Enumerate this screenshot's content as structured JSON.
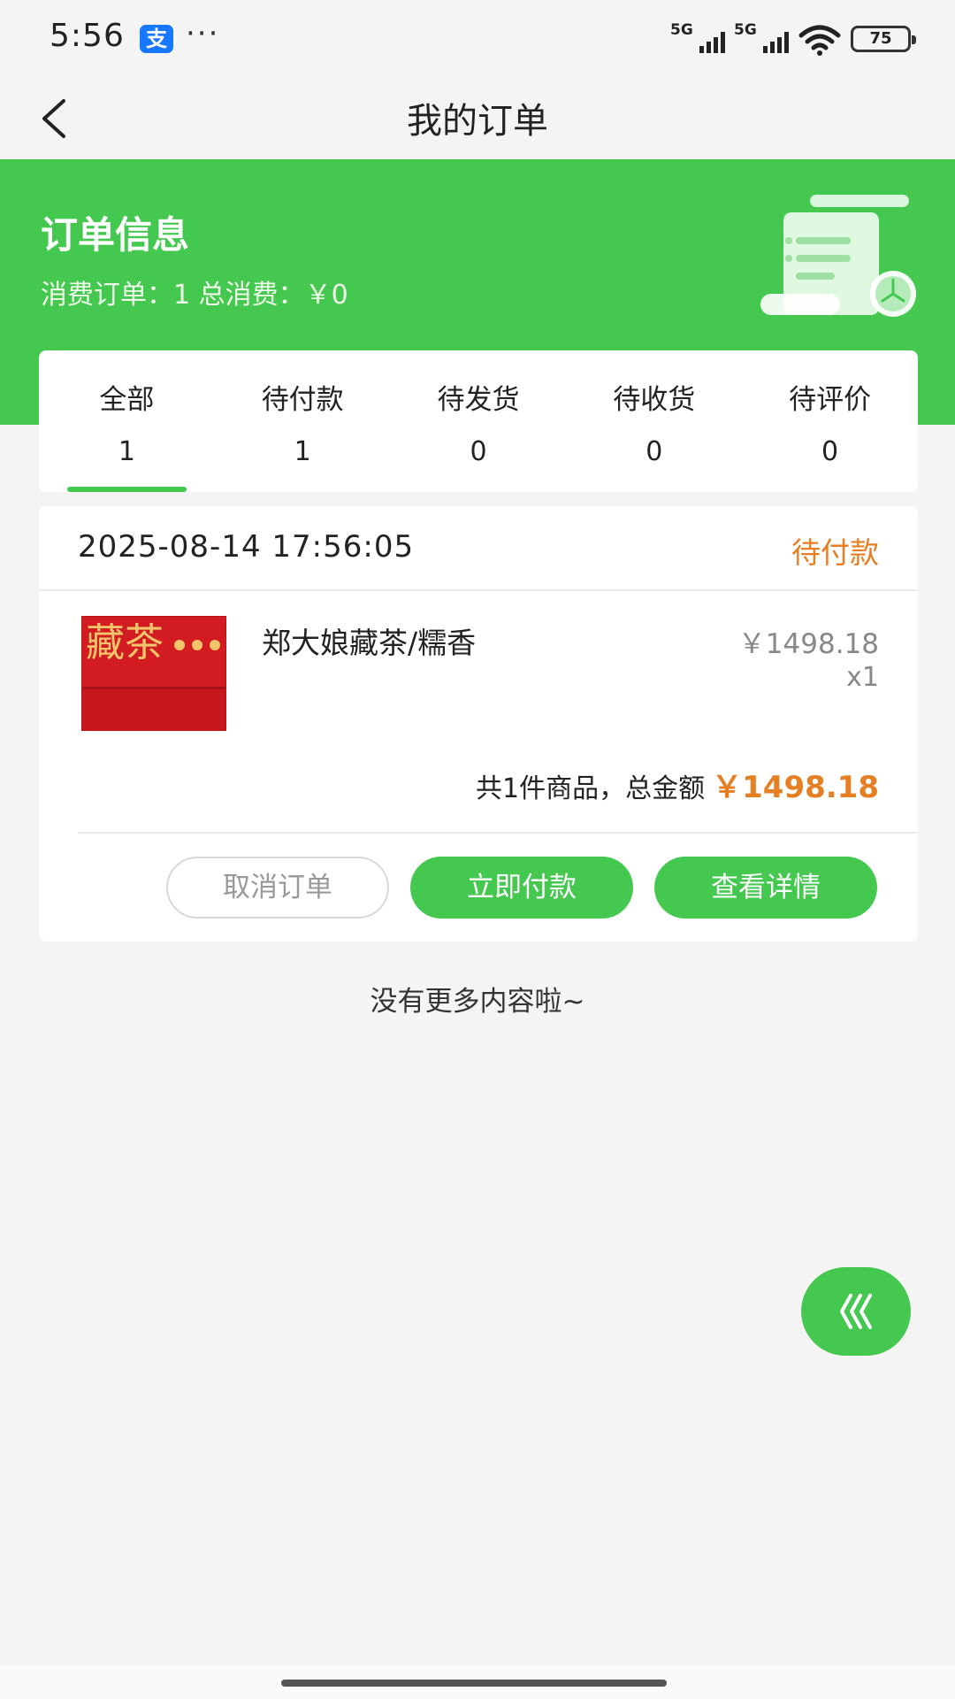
{
  "status_bar": {
    "time": "5:56",
    "app_badge": "支",
    "overflow": "···",
    "signal_1": "5G",
    "signal_2": "5G",
    "battery": "75"
  },
  "nav": {
    "title": "我的订单"
  },
  "order_info": {
    "title": "订单信息",
    "summary": "消费订单：1 总消费：￥0"
  },
  "tabs": [
    {
      "label": "全部",
      "count": "1"
    },
    {
      "label": "待付款",
      "count": "1"
    },
    {
      "label": "待发货",
      "count": "0"
    },
    {
      "label": "待收货",
      "count": "0"
    },
    {
      "label": "待评价",
      "count": "0"
    }
  ],
  "active_tab": "全部",
  "order": {
    "datetime": "2025-08-14 17:56:05",
    "status": "待付款",
    "product": {
      "name": "郑大娘藏茶/糯香",
      "price": "￥1498.18",
      "quantity": "x1",
      "thumbnail_text": "藏茶"
    },
    "summary_text": "共1件商品，总金额",
    "total": "￥1498.18",
    "buttons": {
      "cancel": "取消订单",
      "pay": "立即付款",
      "detail": "查看详情"
    }
  },
  "footer": {
    "no_more": "没有更多内容啦~"
  },
  "colors": {
    "brand_green": "#45c84f",
    "accent_orange": "#e67e22",
    "background": "#f4f4f5"
  }
}
